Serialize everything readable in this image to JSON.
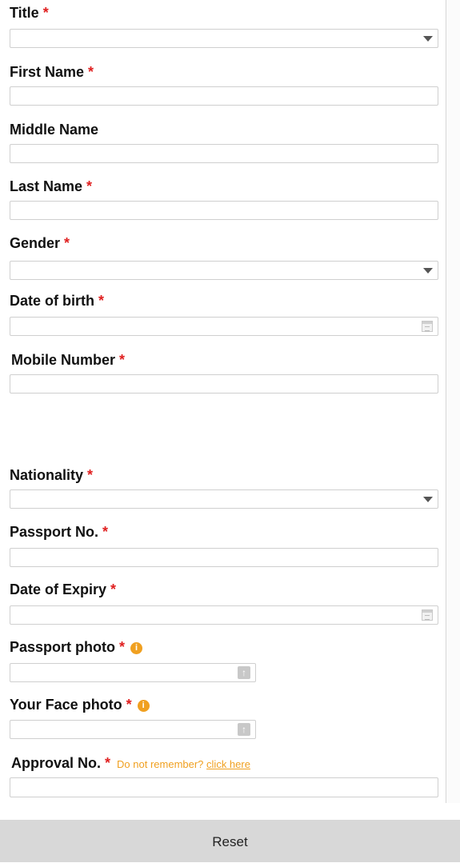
{
  "form": {
    "title_label": "Title",
    "first_name_label": "First Name",
    "middle_name_label": "Middle Name",
    "last_name_label": "Last Name",
    "gender_label": "Gender",
    "dob_label": "Date of birth",
    "mobile_label": "Mobile Number",
    "nationality_label": "Nationality",
    "passport_no_label": "Passport No.",
    "expiry_label": "Date of Expiry",
    "passport_photo_label": "Passport photo",
    "face_photo_label": "Your Face photo",
    "approval_label": "Approval No.",
    "approval_hint": "Do not remember?",
    "approval_link": "click here",
    "required_marker": "*",
    "info_glyph": "i"
  },
  "actions": {
    "reset_label": "Reset"
  },
  "colors": {
    "required": "#e02020",
    "hint": "#f0a020",
    "button_bg": "#d8d8d8"
  },
  "icons": {
    "select": "chevron-down-icon",
    "date": "calendar-icon",
    "file": "upload-icon",
    "info": "info-icon"
  }
}
